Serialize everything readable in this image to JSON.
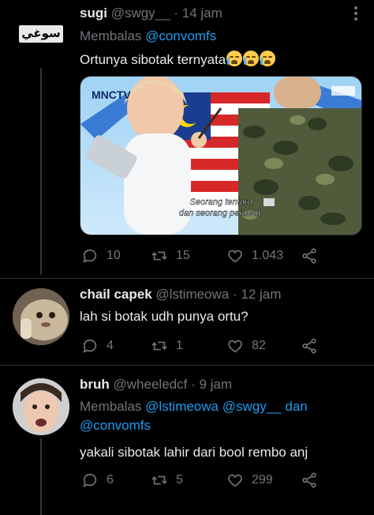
{
  "tweets": [
    {
      "name": "sugi",
      "handle": "@swgy__",
      "separator": "·",
      "time": "14 jam",
      "reply_prefix": "Membalas",
      "mentions": [
        "@convomfs"
      ],
      "avatar_text": "سوغي",
      "text": "Ortunya sibotak ternyata",
      "emoji": "loudly-crying-face",
      "media_caption_line1": "Seorang tentara",
      "media_caption_line2": "dan seorang perawat.",
      "media_logo": "MNCTV",
      "replies": "10",
      "retweets": "15",
      "likes": "1.043"
    },
    {
      "name": "chail capek",
      "handle": "@lstimeowa",
      "separator": "·",
      "time": "12 jam",
      "text": "lah si botak udh punya ortu?",
      "replies": "4",
      "retweets": "1",
      "likes": "82"
    },
    {
      "name": "bruh",
      "handle": "@wheeledcf",
      "separator": "·",
      "time": "9 jam",
      "reply_prefix": "Membalas",
      "mentions": [
        "@lstimeowa",
        "@swgy__",
        "@convomfs"
      ],
      "mention_joiner": "dan",
      "text": "yakali sibotak lahir dari bool rembo anj",
      "replies": "6",
      "retweets": "5",
      "likes": "299"
    }
  ],
  "colors": {
    "background": "#000000",
    "text": "#e7e9ea",
    "muted": "#71767b",
    "link": "#1d9bf0",
    "divider": "#2f3336"
  }
}
